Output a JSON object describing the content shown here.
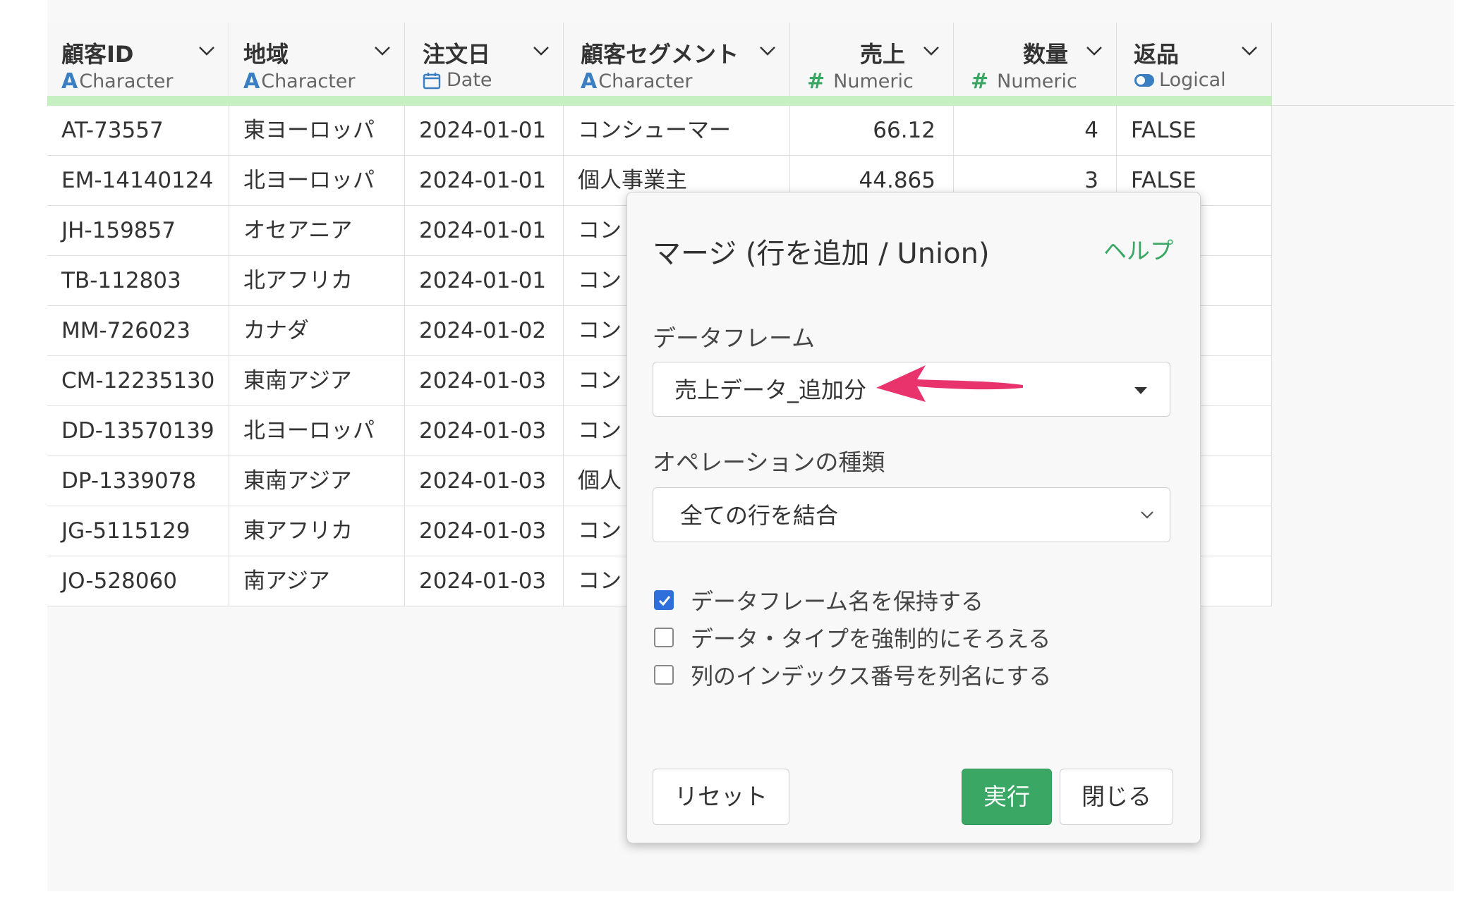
{
  "columns": [
    {
      "name": "顧客ID",
      "type_icon": "A",
      "type": "Character"
    },
    {
      "name": "地域",
      "type_icon": "A",
      "type": "Character"
    },
    {
      "name": "注文日",
      "type_icon": "calendar-icon",
      "type": "Date"
    },
    {
      "name": "顧客セグメント",
      "type_icon": "A",
      "type": "Character"
    },
    {
      "name": "売上",
      "type_icon": "#",
      "type": "Numeric"
    },
    {
      "name": "数量",
      "type_icon": "#",
      "type": "Numeric"
    },
    {
      "name": "返品",
      "type_icon": "toggle-icon",
      "type": "Logical"
    }
  ],
  "rows": [
    [
      "AT-73557",
      "東ヨーロッパ",
      "2024-01-01",
      "コンシューマー",
      "66.12",
      "4",
      "FALSE"
    ],
    [
      "EM-14140124",
      "北ヨーロッパ",
      "2024-01-01",
      "個人事業主",
      "44.865",
      "3",
      "FALSE"
    ],
    [
      "JH-159857",
      "オセアニア",
      "2024-01-01",
      "コン",
      "",
      "",
      ""
    ],
    [
      "TB-112803",
      "北アフリカ",
      "2024-01-01",
      "コン",
      "",
      "",
      ""
    ],
    [
      "MM-726023",
      "カナダ",
      "2024-01-02",
      "コン",
      "",
      "",
      ""
    ],
    [
      "CM-12235130",
      "東南アジア",
      "2024-01-03",
      "コン",
      "",
      "",
      ""
    ],
    [
      "DD-13570139",
      "北ヨーロッパ",
      "2024-01-03",
      "コン",
      "",
      "",
      ""
    ],
    [
      "DP-1339078",
      "東南アジア",
      "2024-01-03",
      "個人",
      "",
      "",
      ""
    ],
    [
      "JG-5115129",
      "東アフリカ",
      "2024-01-03",
      "コン",
      "",
      "",
      ""
    ],
    [
      "JO-528060",
      "南アジア",
      "2024-01-03",
      "コン",
      "",
      "",
      ""
    ]
  ],
  "dialog": {
    "title": "マージ (行を追加 / Union)",
    "help": "ヘルプ",
    "dataframe_label": "データフレーム",
    "dataframe_value": "売上データ_追加分",
    "operation_label": "オペレーションの種類",
    "operation_value": "全ての行を結合",
    "checkboxes": [
      {
        "label": "データフレーム名を保持する",
        "checked": true
      },
      {
        "label": "データ・タイプを強制的にそろえる",
        "checked": false
      },
      {
        "label": "列のインデックス番号を列名にする",
        "checked": false
      }
    ],
    "reset": "リセット",
    "run": "実行",
    "close": "閉じる"
  },
  "colors": {
    "accent_green": "#3aa864",
    "header_accent": "#c6f0c1",
    "arrow": "#e8336d",
    "checkbox_blue": "#2f6fdb"
  }
}
